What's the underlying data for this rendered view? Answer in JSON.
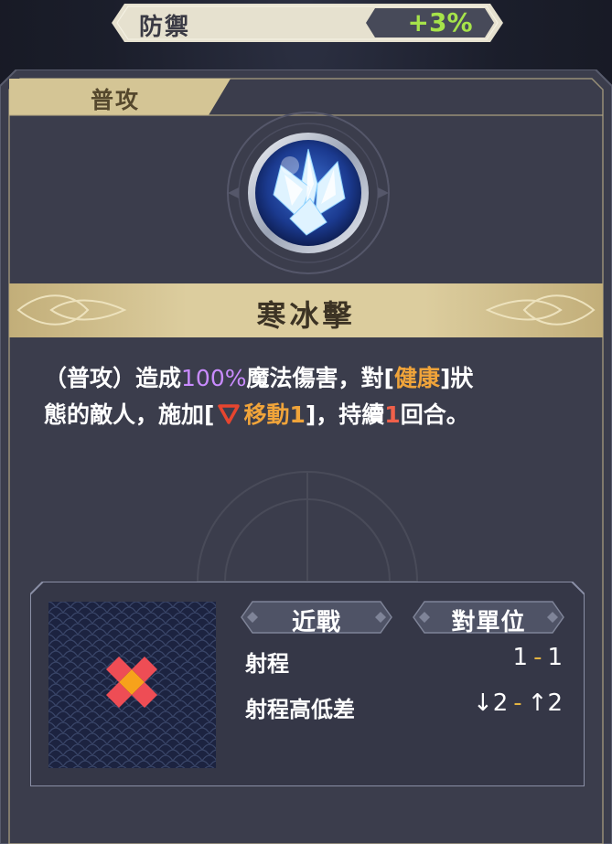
{
  "stat_banner": {
    "label": "防禦",
    "value": "+3%"
  },
  "panel": {
    "tab": "普攻"
  },
  "skill": {
    "name": "寒冰擊"
  },
  "description": {
    "line1_a": "（普攻）造成",
    "line1_pct": "100%",
    "line1_b": "魔法傷害，對[",
    "line1_status": "健康",
    "line1_c": "]狀",
    "line2_a": "態的敵人，施加[",
    "line2_effect": "移動1",
    "line2_b": "]，持續",
    "line2_turns": "1",
    "line2_c": "回合。"
  },
  "range": {
    "pill_type": "近戰",
    "pill_target": "對單位",
    "range_label": "射程",
    "range_min": "1",
    "range_sep": "-",
    "range_max": "1",
    "height_label": "射程高低差",
    "height_down": "↓2",
    "height_up": "↑2"
  },
  "colors": {
    "gold": "#dccd9e",
    "panel_bg": "#3a3c4b",
    "value_green": "#a6e34a",
    "highlight_purple": "#c98bff",
    "highlight_orange": "#f0a43a",
    "highlight_red": "#f0604a",
    "range_center": "#f7a21b",
    "range_cell": "#ee4d55"
  },
  "icons": [
    "crystal-ice-skill-icon",
    "down-triangle-debuff-icon",
    "range-pattern-icon"
  ]
}
